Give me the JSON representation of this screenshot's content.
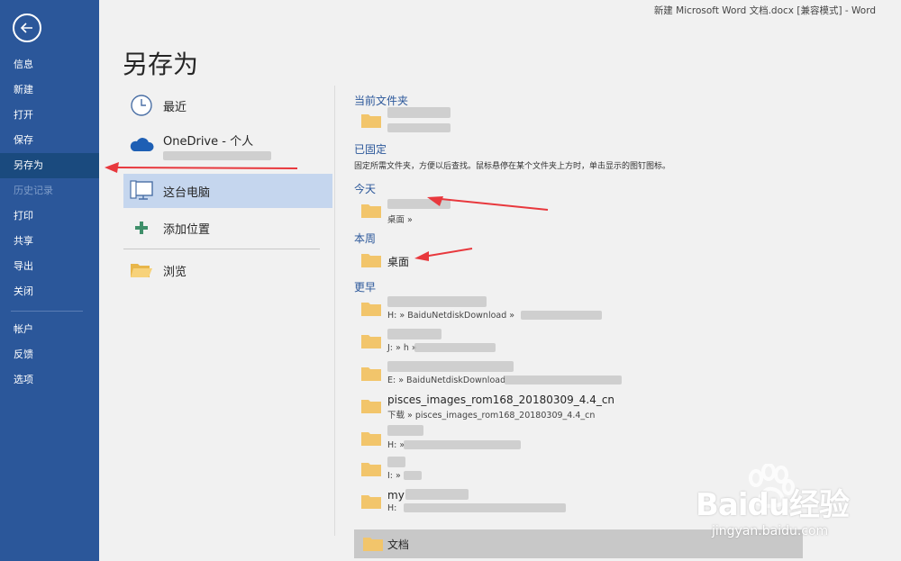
{
  "window_title": "新建 Microsoft Word 文档.docx [兼容模式]  -  Word",
  "page_title": "另存为",
  "nav": {
    "items": [
      {
        "label": "信息"
      },
      {
        "label": "新建"
      },
      {
        "label": "打开"
      },
      {
        "label": "保存"
      },
      {
        "label": "另存为"
      },
      {
        "label": "历史记录"
      },
      {
        "label": "打印"
      },
      {
        "label": "共享"
      },
      {
        "label": "导出"
      },
      {
        "label": "关闭"
      },
      {
        "label": "帐户"
      },
      {
        "label": "反馈"
      },
      {
        "label": "选项"
      }
    ]
  },
  "locations": {
    "recent": "最近",
    "onedrive": "OneDrive - 个人",
    "this_pc": "这台电脑",
    "add_place": "添加位置",
    "browse": "浏览"
  },
  "sections": {
    "current_folder": "当前文件夹",
    "pinned": "已固定",
    "pinned_hint": "固定所需文件夹，方便以后查找。鼠标悬停在某个文件夹上方时，单击显示的图钉图标。",
    "today": "今天",
    "this_week": "本周",
    "older": "更早"
  },
  "folders": {
    "today_path": "桌面 » ",
    "this_week_name": "桌面",
    "older": [
      {
        "name": "",
        "path": "H: » BaiduNetdiskDownload » "
      },
      {
        "name": "",
        "path": "J: » h » "
      },
      {
        "name": "",
        "path": "E: » BaiduNetdiskDownload"
      },
      {
        "name": "pisces_images_rom168_20180309_4.4_cn",
        "path": "下载 » pisces_images_rom168_20180309_4.4_cn"
      },
      {
        "name": "",
        "path": "H: » "
      },
      {
        "name": "",
        "path": "I: » "
      },
      {
        "name": "my",
        "path": "H: "
      }
    ],
    "documents": "文档"
  },
  "watermark": {
    "brand": "Baidu经验",
    "url": "jingyan.baidu.com"
  },
  "colors": {
    "nav_bg": "#2b579a",
    "accent": "#2b579a",
    "selected_location": "#c5d6ee",
    "folder": "#f2c56b",
    "arrow": "#e8383d"
  }
}
